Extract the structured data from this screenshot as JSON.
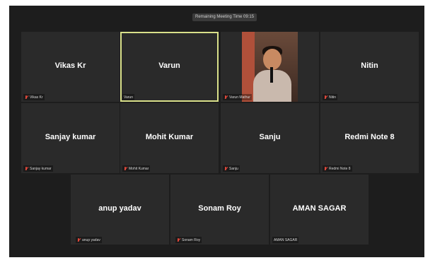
{
  "meeting": {
    "remaining_time_text": "Remaining Meeting Time 09:15"
  },
  "participants": [
    {
      "name": "Vikas Kr",
      "label": "Vikas Kr",
      "muted": true,
      "active": false,
      "video": false
    },
    {
      "name": "Varun",
      "label": "Varun",
      "muted": false,
      "active": true,
      "video": false
    },
    {
      "name": "",
      "label": "Varun Mathur",
      "muted": true,
      "active": false,
      "video": true
    },
    {
      "name": "Nitin",
      "label": "Nitin",
      "muted": true,
      "active": false,
      "video": false
    },
    {
      "name": "Sanjay kumar",
      "label": "Sanjay kumar",
      "muted": true,
      "active": false,
      "video": false
    },
    {
      "name": "Mohit Kumar",
      "label": "Mohit Kumar",
      "muted": true,
      "active": false,
      "video": false
    },
    {
      "name": "Sanju",
      "label": "Sanju",
      "muted": true,
      "active": false,
      "video": false
    },
    {
      "name": "Redmi Note 8",
      "label": "Redmi Note 8",
      "muted": true,
      "active": false,
      "video": false
    },
    {
      "name": "anup yadav",
      "label": "anup yadav",
      "muted": true,
      "active": false,
      "video": false
    },
    {
      "name": "Sonam Roy",
      "label": "Sonam Roy",
      "muted": true,
      "active": false,
      "video": false
    },
    {
      "name": "AMAN SAGAR",
      "label": "AMAN SAGAR",
      "muted": false,
      "active": false,
      "video": false
    }
  ],
  "colors": {
    "background": "#1d1d1d",
    "tile": "#2a2a2a",
    "active_border": "#d9e08a",
    "muted_icon": "#e0473a"
  }
}
